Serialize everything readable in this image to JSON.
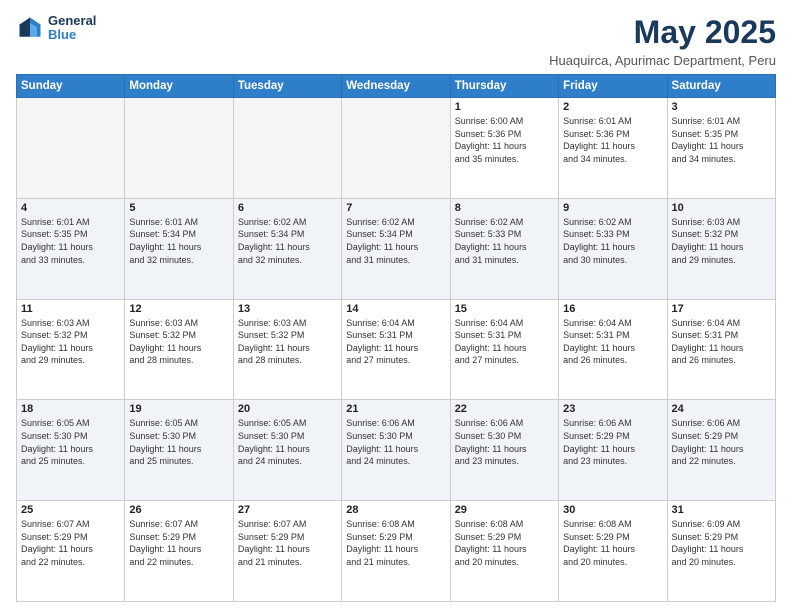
{
  "header": {
    "logo_line1": "General",
    "logo_line2": "Blue",
    "title": "May 2025",
    "location": "Huaquirca, Apurimac Department, Peru"
  },
  "days_of_week": [
    "Sunday",
    "Monday",
    "Tuesday",
    "Wednesday",
    "Thursday",
    "Friday",
    "Saturday"
  ],
  "weeks": [
    [
      {
        "day": "",
        "info": ""
      },
      {
        "day": "",
        "info": ""
      },
      {
        "day": "",
        "info": ""
      },
      {
        "day": "",
        "info": ""
      },
      {
        "day": "1",
        "info": "Sunrise: 6:00 AM\nSunset: 5:36 PM\nDaylight: 11 hours\nand 35 minutes."
      },
      {
        "day": "2",
        "info": "Sunrise: 6:01 AM\nSunset: 5:36 PM\nDaylight: 11 hours\nand 34 minutes."
      },
      {
        "day": "3",
        "info": "Sunrise: 6:01 AM\nSunset: 5:35 PM\nDaylight: 11 hours\nand 34 minutes."
      }
    ],
    [
      {
        "day": "4",
        "info": "Sunrise: 6:01 AM\nSunset: 5:35 PM\nDaylight: 11 hours\nand 33 minutes."
      },
      {
        "day": "5",
        "info": "Sunrise: 6:01 AM\nSunset: 5:34 PM\nDaylight: 11 hours\nand 32 minutes."
      },
      {
        "day": "6",
        "info": "Sunrise: 6:02 AM\nSunset: 5:34 PM\nDaylight: 11 hours\nand 32 minutes."
      },
      {
        "day": "7",
        "info": "Sunrise: 6:02 AM\nSunset: 5:34 PM\nDaylight: 11 hours\nand 31 minutes."
      },
      {
        "day": "8",
        "info": "Sunrise: 6:02 AM\nSunset: 5:33 PM\nDaylight: 11 hours\nand 31 minutes."
      },
      {
        "day": "9",
        "info": "Sunrise: 6:02 AM\nSunset: 5:33 PM\nDaylight: 11 hours\nand 30 minutes."
      },
      {
        "day": "10",
        "info": "Sunrise: 6:03 AM\nSunset: 5:32 PM\nDaylight: 11 hours\nand 29 minutes."
      }
    ],
    [
      {
        "day": "11",
        "info": "Sunrise: 6:03 AM\nSunset: 5:32 PM\nDaylight: 11 hours\nand 29 minutes."
      },
      {
        "day": "12",
        "info": "Sunrise: 6:03 AM\nSunset: 5:32 PM\nDaylight: 11 hours\nand 28 minutes."
      },
      {
        "day": "13",
        "info": "Sunrise: 6:03 AM\nSunset: 5:32 PM\nDaylight: 11 hours\nand 28 minutes."
      },
      {
        "day": "14",
        "info": "Sunrise: 6:04 AM\nSunset: 5:31 PM\nDaylight: 11 hours\nand 27 minutes."
      },
      {
        "day": "15",
        "info": "Sunrise: 6:04 AM\nSunset: 5:31 PM\nDaylight: 11 hours\nand 27 minutes."
      },
      {
        "day": "16",
        "info": "Sunrise: 6:04 AM\nSunset: 5:31 PM\nDaylight: 11 hours\nand 26 minutes."
      },
      {
        "day": "17",
        "info": "Sunrise: 6:04 AM\nSunset: 5:31 PM\nDaylight: 11 hours\nand 26 minutes."
      }
    ],
    [
      {
        "day": "18",
        "info": "Sunrise: 6:05 AM\nSunset: 5:30 PM\nDaylight: 11 hours\nand 25 minutes."
      },
      {
        "day": "19",
        "info": "Sunrise: 6:05 AM\nSunset: 5:30 PM\nDaylight: 11 hours\nand 25 minutes."
      },
      {
        "day": "20",
        "info": "Sunrise: 6:05 AM\nSunset: 5:30 PM\nDaylight: 11 hours\nand 24 minutes."
      },
      {
        "day": "21",
        "info": "Sunrise: 6:06 AM\nSunset: 5:30 PM\nDaylight: 11 hours\nand 24 minutes."
      },
      {
        "day": "22",
        "info": "Sunrise: 6:06 AM\nSunset: 5:30 PM\nDaylight: 11 hours\nand 23 minutes."
      },
      {
        "day": "23",
        "info": "Sunrise: 6:06 AM\nSunset: 5:29 PM\nDaylight: 11 hours\nand 23 minutes."
      },
      {
        "day": "24",
        "info": "Sunrise: 6:06 AM\nSunset: 5:29 PM\nDaylight: 11 hours\nand 22 minutes."
      }
    ],
    [
      {
        "day": "25",
        "info": "Sunrise: 6:07 AM\nSunset: 5:29 PM\nDaylight: 11 hours\nand 22 minutes."
      },
      {
        "day": "26",
        "info": "Sunrise: 6:07 AM\nSunset: 5:29 PM\nDaylight: 11 hours\nand 22 minutes."
      },
      {
        "day": "27",
        "info": "Sunrise: 6:07 AM\nSunset: 5:29 PM\nDaylight: 11 hours\nand 21 minutes."
      },
      {
        "day": "28",
        "info": "Sunrise: 6:08 AM\nSunset: 5:29 PM\nDaylight: 11 hours\nand 21 minutes."
      },
      {
        "day": "29",
        "info": "Sunrise: 6:08 AM\nSunset: 5:29 PM\nDaylight: 11 hours\nand 20 minutes."
      },
      {
        "day": "30",
        "info": "Sunrise: 6:08 AM\nSunset: 5:29 PM\nDaylight: 11 hours\nand 20 minutes."
      },
      {
        "day": "31",
        "info": "Sunrise: 6:09 AM\nSunset: 5:29 PM\nDaylight: 11 hours\nand 20 minutes."
      }
    ]
  ]
}
